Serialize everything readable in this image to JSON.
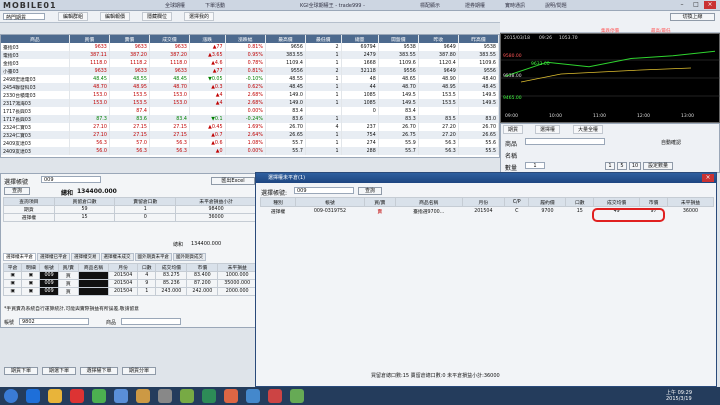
{
  "app": {
    "logo": "MOBILE01",
    "title": "KGI全球期權王 - trade999 -",
    "menu": [
      "全球期權",
      "下單活動",
      "標配顯示",
      "證券期權",
      "實時通訊"
    ],
    "help": "說明/問題"
  },
  "toolbar": {
    "tabs": [
      "編輯群組",
      "編輯報價",
      "隱藏欄位",
      "選擇我的"
    ],
    "group": "熱門期貨",
    "login": "切換上線"
  },
  "quote": {
    "headers": [
      "商品",
      "買價",
      "賣價",
      "成交價",
      "漲跌",
      "漲跌幅",
      "最高價",
      "最低價",
      "總量",
      "開盤價",
      "昨收",
      "昨高價"
    ],
    "rows": [
      [
        "臺指03",
        "9633",
        "9633",
        "9633",
        "▲77",
        "0.81%",
        "9656",
        "2",
        "69794",
        "9538",
        "9649",
        "9538"
      ],
      [
        "電指03",
        "387.11",
        "387.20",
        "387.20",
        "▲3.65",
        "0.95%",
        "383.55",
        "1",
        "2479",
        "383.55",
        "387.80",
        "383.55"
      ],
      [
        "金指03",
        "1118.0",
        "1118.2",
        "1118.0",
        "▲4.6",
        "0.78%",
        "1109.4",
        "1",
        "1668",
        "1109.6",
        "1120.4",
        "1109.6"
      ],
      [
        "小臺03",
        "9633",
        "9633",
        "9633",
        "▲77",
        "0.81%",
        "9556",
        "2",
        "32118",
        "9556",
        "9649",
        "9556"
      ],
      [
        "2498宏達電03",
        "48.45",
        "48.55",
        "48.45",
        "▼0.05",
        "-0.10%",
        "48.55",
        "1",
        "48",
        "48.65",
        "48.90",
        "48.40"
      ],
      [
        "2454聯發科03",
        "48.70",
        "48.95",
        "48.70",
        "▲0.3",
        "0.62%",
        "48.45",
        "1",
        "44",
        "48.70",
        "48.95",
        "48.45"
      ],
      [
        "2330台積電03",
        "153.0",
        "153.5",
        "153.0",
        "▲4",
        "2.68%",
        "149.0",
        "1",
        "1085",
        "149.5",
        "153.5",
        "149.5"
      ],
      [
        "2317鴻海03",
        "153.0",
        "153.5",
        "153.0",
        "▲4",
        "2.68%",
        "149.0",
        "1",
        "1085",
        "149.5",
        "153.5",
        "149.5"
      ],
      [
        "1717長興03",
        "",
        "87.4",
        "",
        "",
        "0.00%",
        "83.4",
        "",
        "0",
        "83.4",
        "",
        ""
      ],
      [
        "1717長興03",
        "87.3",
        "83.6",
        "83.4",
        "▼0.1",
        "-0.24%",
        "83.6",
        "1",
        "",
        "83.3",
        "83.5",
        "83.0"
      ],
      [
        "2324仁寶03",
        "27.10",
        "27.15",
        "27.15",
        "▲0.45",
        "1.69%",
        "26.70",
        "4",
        "237",
        "26.70",
        "27.20",
        "26.70"
      ],
      [
        "2324仁寶03",
        "27.10",
        "27.15",
        "27.15",
        "▲0.7",
        "2.64%",
        "26.65",
        "1",
        "754",
        "26.75",
        "27.20",
        "26.65"
      ],
      [
        "2409友達03",
        "56.3",
        "57.0",
        "56.3",
        "▲0.6",
        "1.08%",
        "55.7",
        "1",
        "274",
        "55.9",
        "56.3",
        "55.6"
      ],
      [
        "2409友達03",
        "56.0",
        "56.3",
        "56.3",
        "▲0",
        "0.00%",
        "55.7",
        "1",
        "288",
        "55.7",
        "56.3",
        "55.5"
      ]
    ]
  },
  "chart": {
    "date": "2015/03/18",
    "time": "09:26",
    "price": "1053.70",
    "legend": [
      "集跌停價",
      "最高/最低"
    ],
    "labels": {
      "high": "9580.00",
      "mid": "9538.00",
      "low": "9465.00",
      "last": "9633.00"
    },
    "times": [
      "09:00",
      "10:00",
      "11:00",
      "12:00",
      "13:00"
    ]
  },
  "chart_data": {
    "type": "line",
    "x": [
      "09:00",
      "10:00",
      "11:00",
      "12:00",
      "13:00"
    ],
    "series": [
      {
        "values": [
          9560,
          9601,
          9588,
          9612,
          9620,
          9633
        ]
      }
    ]
  },
  "order": {
    "tabs": [
      "期貨",
      "選擇權",
      "大量全權"
    ],
    "product_label": "商品",
    "name_label": "名稱",
    "qty_label": "數量",
    "qty": "1",
    "buttons": [
      "1",
      "5",
      "10",
      "設定數量"
    ],
    "checkbox": "自動確認"
  },
  "account": {
    "label": "選擇帳號",
    "account": "009",
    "name": "Name",
    "prev": "資料 ▸",
    "balance_label": "總和",
    "balance": "134400.000",
    "excel": "匯出Excel",
    "query": "查詢"
  },
  "summary": {
    "headers": [
      "查詢項目",
      "買留倉口數",
      "賣留倉口數",
      "未平倉損益小計"
    ],
    "rows": [
      [
        "期貨",
        "59",
        "1",
        "98400"
      ],
      [
        "選擇權",
        "15",
        "0",
        "36000"
      ]
    ],
    "total_label": "總和",
    "total": "134400.000"
  },
  "positions": {
    "tabs": [
      "選擇權未平倉",
      "選擇權已平倉",
      "選擇權交易",
      "選擇權未成交",
      "國外期貨未平倉",
      "國外期貨成交"
    ],
    "headers": [
      "平倉",
      "明細",
      "帳號",
      "買/賣",
      "商品名稱",
      "月份",
      "口數",
      "成交均價",
      "市價",
      "未平損益"
    ],
    "rows": [
      [
        "",
        "",
        "009",
        "買",
        "",
        "201504",
        "4",
        "83.275",
        "83.400",
        "1000.000"
      ],
      [
        "",
        "",
        "009",
        "買",
        "",
        "201504",
        "9",
        "85.236",
        "87.200",
        "35000.000"
      ],
      [
        "",
        "",
        "009",
        "買",
        "",
        "201504",
        "1",
        "243.000",
        "242.000",
        "2000.000"
      ]
    ],
    "note": "*手買賣為系統自行運算統計,可能與實際損益有所誤差,敬請留意"
  },
  "orderbar": {
    "account_label": "帳號",
    "account": "9802",
    "product_label": "商品"
  },
  "dialog": {
    "title": "選擇權未平倉(1)",
    "account_label": "選擇帳號:",
    "account": "009",
    "query": "查詢",
    "headers": [
      "種別",
      "帳號",
      "買/賣",
      "商品名稱",
      "月份",
      "C/P",
      "履約價",
      "口數",
      "成交均價",
      "市價",
      "未平損益"
    ],
    "rows": [
      [
        "選擇權",
        "009-0319752",
        "賣",
        "臺指選9700...",
        "201504",
        "C",
        "9700",
        "15",
        "49",
        "97",
        "36000"
      ]
    ],
    "status_buy_label": "買留倉總口數:",
    "status_buy": "15",
    "status_sell_label": "賣留倉總口數:",
    "status_sell": "0",
    "status_pnl_label": "未平倉損益小計:",
    "status_pnl": "36000"
  },
  "bottom_buttons": [
    "期貨下單",
    "期選下單",
    "選擇權下單",
    "期貨分單"
  ],
  "taskbar": {
    "time": "上午 09:29",
    "date": "2015/3/19"
  }
}
